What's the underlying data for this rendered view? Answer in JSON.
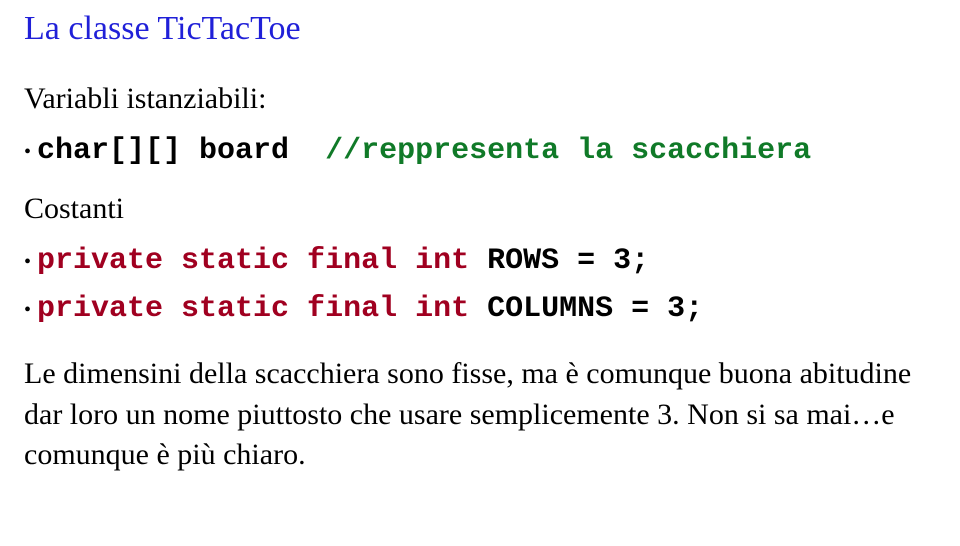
{
  "title": "La classe TicTacToe",
  "intro": "Variabli istanziabili:",
  "line1": {
    "bullet": "•",
    "code": "char[][] board  ",
    "comment": "//reppresenta la scacchiera"
  },
  "costanti_label": "Costanti",
  "line2": {
    "bullet": "•",
    "kw": "private static final int ",
    "rest": "ROWS = 3;"
  },
  "line3": {
    "bullet": "•",
    "kw": "private static final int ",
    "rest": "COLUMNS = 3;"
  },
  "paragraph": "Le dimensini della scacchiera sono fisse, ma è comunque buona abitudine dar loro un nome piuttosto che usare semplicemente 3. Non si sa mai…e comunque è più chiaro."
}
